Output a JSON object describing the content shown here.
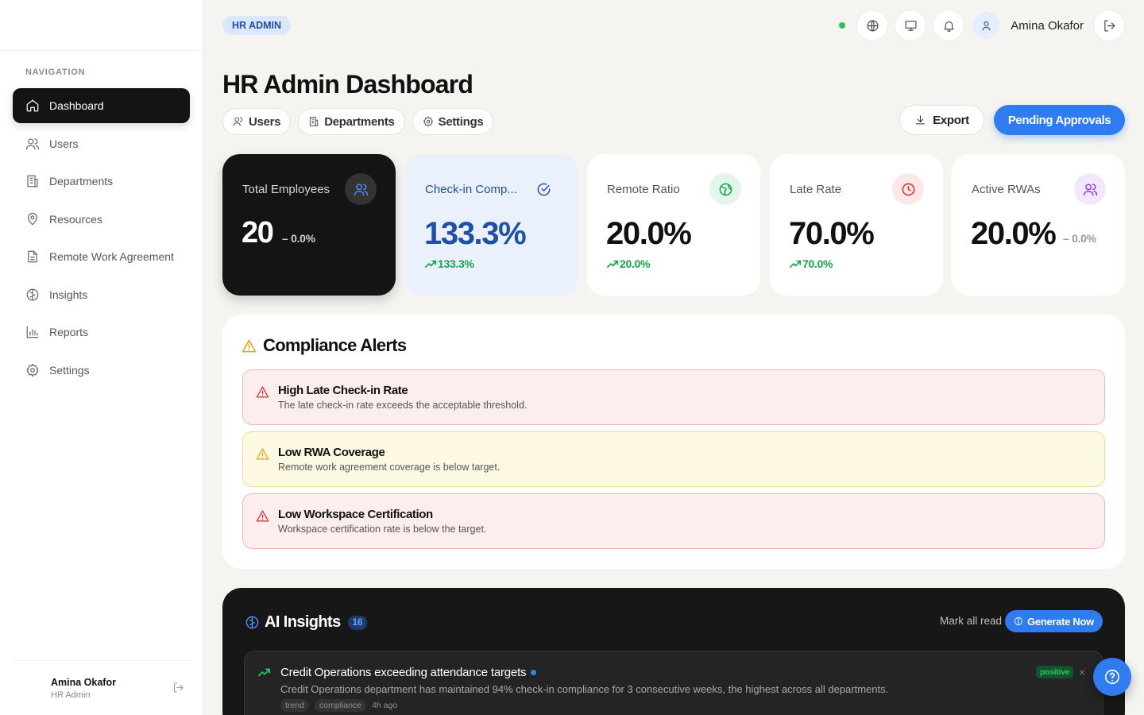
{
  "sidebar": {
    "heading": "NAVIGATION",
    "items": [
      {
        "label": "Dashboard",
        "icon": "home-icon",
        "active": true
      },
      {
        "label": "Users",
        "icon": "users-icon"
      },
      {
        "label": "Departments",
        "icon": "building-icon"
      },
      {
        "label": "Resources",
        "icon": "map-pin-icon"
      },
      {
        "label": "Remote Work Agreement",
        "icon": "document-icon"
      },
      {
        "label": "Insights",
        "icon": "brain-icon"
      },
      {
        "label": "Reports",
        "icon": "bar-chart-icon"
      },
      {
        "label": "Settings",
        "icon": "gear-icon"
      }
    ],
    "user": {
      "name": "Amina Okafor",
      "role": "HR Admin"
    }
  },
  "header": {
    "role_badge": "HR ADMIN",
    "user_name": "Amina Okafor",
    "status_color": "#22c55e"
  },
  "page": {
    "title": "HR Admin Dashboard",
    "quick_tabs": [
      "Users",
      "Departments",
      "Settings"
    ],
    "export_label": "Export",
    "pending_label": "Pending Approvals"
  },
  "stats": [
    {
      "label": "Total Employees",
      "value": "20",
      "trend": "0.0%",
      "trend_dir": "neutral",
      "icon": "users-icon"
    },
    {
      "label": "Check-in Comp...",
      "value": "133.3%",
      "trend": "133.3%",
      "trend_dir": "up",
      "icon": "check-circle-icon"
    },
    {
      "label": "Remote Ratio",
      "value": "20.0%",
      "trend": "20.0%",
      "trend_dir": "up",
      "icon": "globe-icon"
    },
    {
      "label": "Late Rate",
      "value": "70.0%",
      "trend": "70.0%",
      "trend_dir": "up",
      "icon": "clock-icon"
    },
    {
      "label": "Active RWAs",
      "value": "20.0%",
      "trend": "0.0%",
      "trend_dir": "neutral",
      "icon": "users-icon"
    }
  ],
  "compliance": {
    "title": "Compliance Alerts",
    "alerts": [
      {
        "title": "High Late Check-in Rate",
        "desc": "The late check-in rate exceeds the acceptable threshold.",
        "severity": "red"
      },
      {
        "title": "Low RWA Coverage",
        "desc": "Remote work agreement coverage is below target.",
        "severity": "yellow"
      },
      {
        "title": "Low Workspace Certification",
        "desc": "Workspace certification rate is below the target.",
        "severity": "red"
      }
    ]
  },
  "ai": {
    "title": "AI Insights",
    "count": "16",
    "mark_read": "Mark all read",
    "generate": "Generate Now",
    "insight": {
      "title": "Credit Operations exceeding attendance targets",
      "desc": "Credit Operations department has maintained 94% check-in compliance for 3 consecutive weeks, the highest across all departments.",
      "tags": [
        "trend",
        "compliance"
      ],
      "ago": "4h ago",
      "badge": "positive",
      "close": "×"
    }
  },
  "colors": {
    "accent": "#2f7cf0",
    "dark": "#141414",
    "positive": "#16a34a"
  }
}
